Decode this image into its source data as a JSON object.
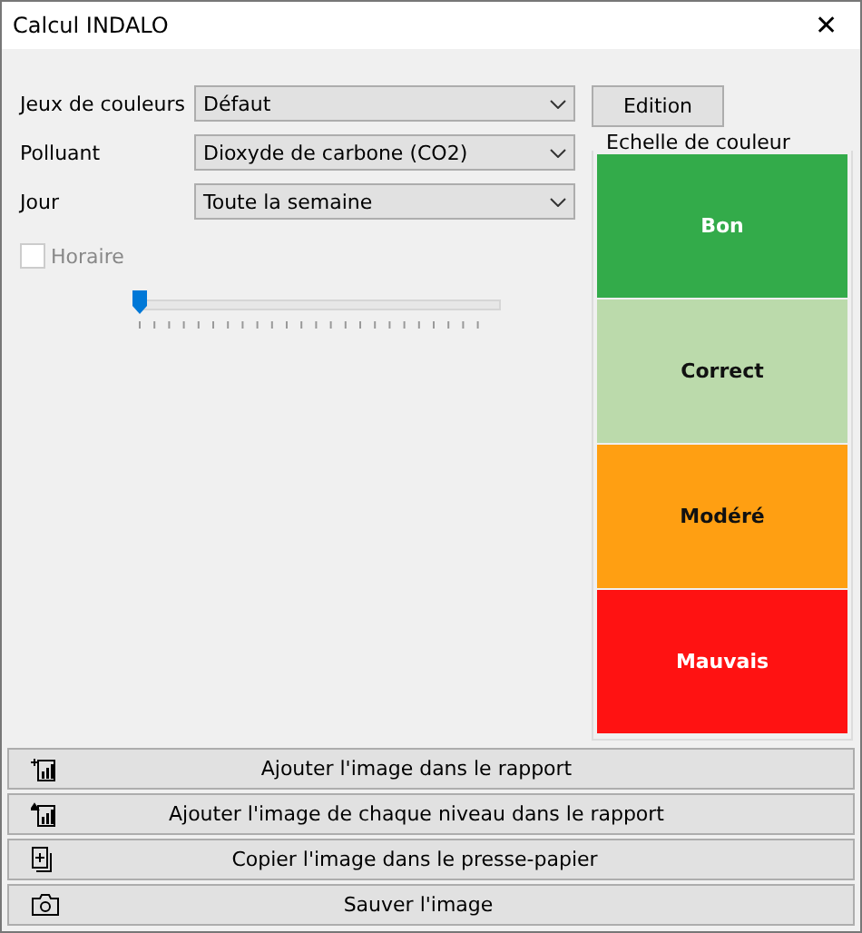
{
  "window": {
    "title": "Calcul INDALO",
    "close": "✕"
  },
  "fields": [
    {
      "label": "Jeux de couleurs",
      "value": "Défaut"
    },
    {
      "label": "Polluant",
      "value": "Dioxyde de carbone (CO2)"
    },
    {
      "label": "Jour",
      "value": "Toute la semaine"
    }
  ],
  "edit_button": "Edition",
  "horaire": {
    "label": "Horaire",
    "checked": false,
    "disabled": true
  },
  "slider": {
    "level": 0
  },
  "scale": {
    "title": "Echelle de couleur",
    "items": [
      {
        "label": "Bon",
        "color": "#33ab4a"
      },
      {
        "label": "Correct",
        "color": "#bbdaab"
      },
      {
        "label": "Modéré",
        "color": "#ff9f12"
      },
      {
        "label": "Mauvais",
        "color": "#ff1212"
      }
    ]
  },
  "actions": [
    {
      "kind": "add",
      "label": "Ajouter l'image dans le rapport"
    },
    {
      "kind": "add-all",
      "label": "Ajouter l'image de chaque niveau dans le rapport"
    },
    {
      "kind": "copy",
      "label": "Copier l'image dans le presse-papier"
    },
    {
      "kind": "save",
      "label": "Sauver l'image"
    }
  ]
}
